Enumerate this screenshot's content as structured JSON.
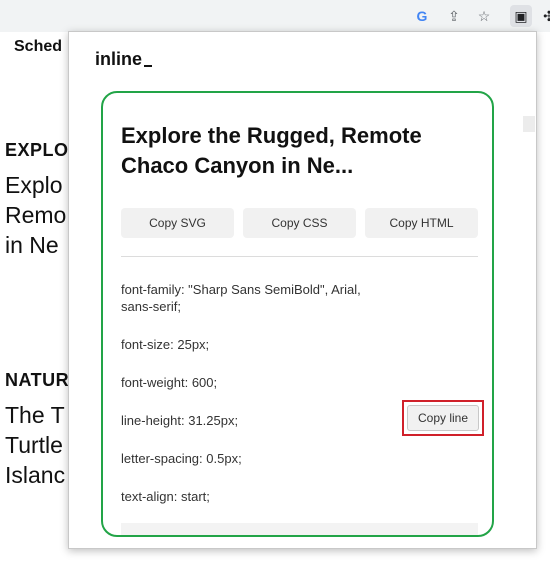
{
  "browser": {
    "toolbar_icons": [
      "google-icon",
      "share-icon",
      "star-icon",
      "extension-sidebar-icon",
      "puzzle-icon"
    ],
    "icon_glyphs": {
      "google": "G",
      "share": "⇪",
      "star": "☆",
      "ext": "▣",
      "puzzle": "✣"
    }
  },
  "background_page": {
    "header_text": "Sched",
    "sections": [
      {
        "category": "EXPLO",
        "title_lines": [
          "Explo",
          "Remo",
          "in Ne"
        ]
      },
      {
        "category": "NATUR",
        "title_lines": [
          "The T",
          "Turtle",
          "Islanc"
        ]
      }
    ]
  },
  "popup": {
    "brand": "inline",
    "card": {
      "title": "Explore the Rugged, Remote Chaco Canyon in Ne...",
      "buttons": {
        "copy_svg": "Copy SVG",
        "copy_css": "Copy CSS",
        "copy_html": "Copy HTML"
      },
      "properties": [
        "font-family: \"Sharp Sans SemiBold\", Arial, sans-serif;",
        "font-size: 25px;",
        "font-weight: 600;",
        "line-height: 31.25px;",
        "letter-spacing: 0.5px;",
        "text-align: start;"
      ],
      "copy_line_label": "Copy line",
      "highlight_color": "#d0202a",
      "card_border_color": "#22a447"
    }
  }
}
